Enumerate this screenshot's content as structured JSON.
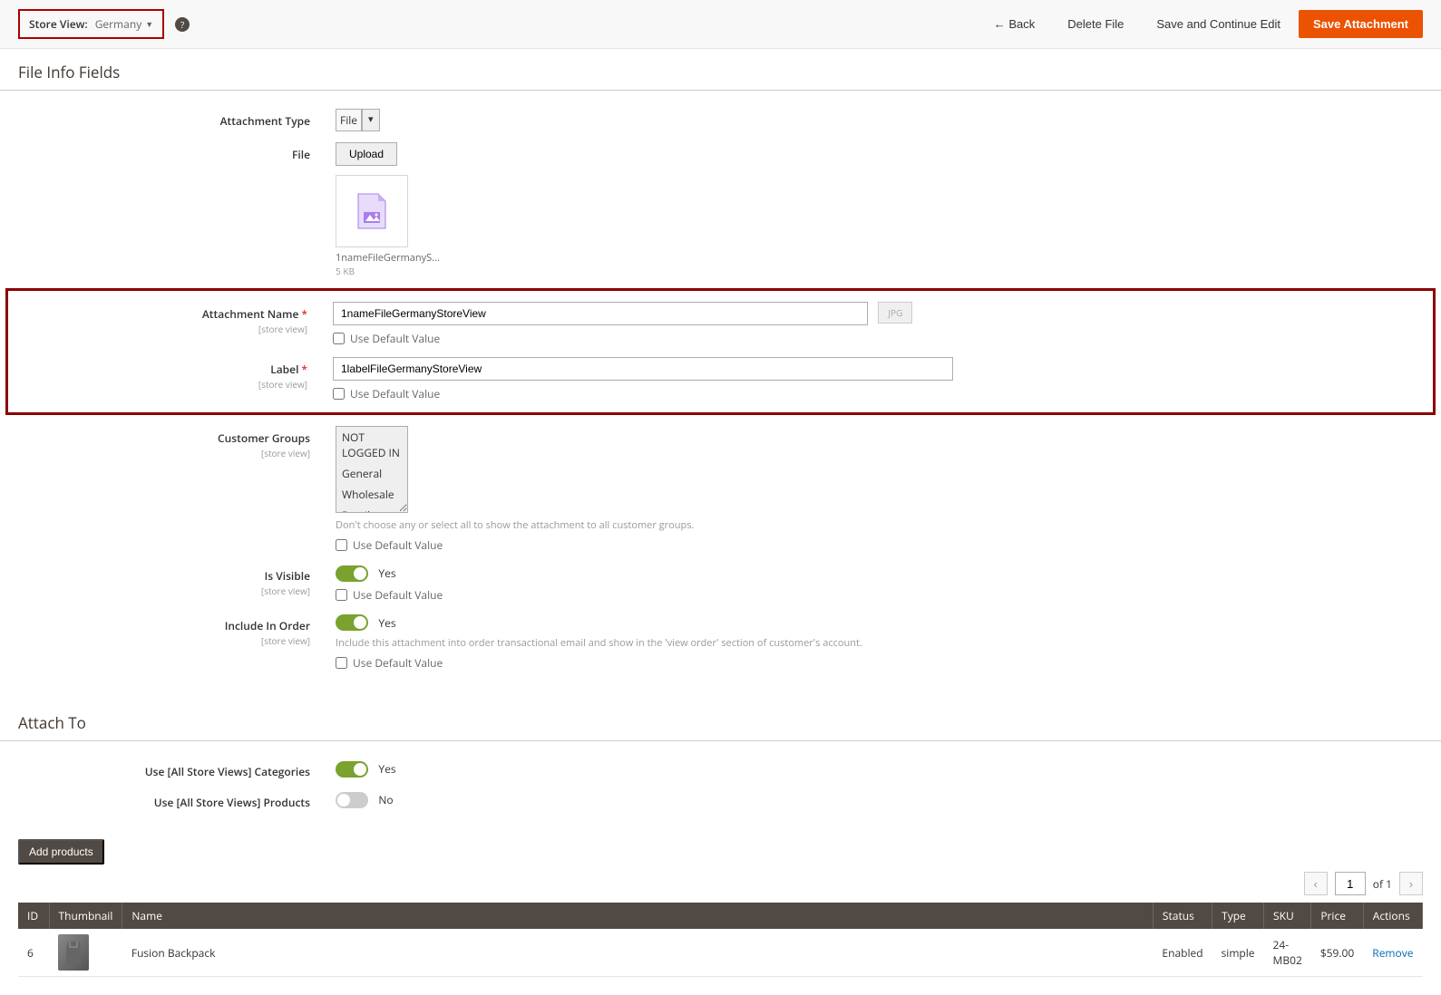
{
  "topbar": {
    "store_view_label": "Store View:",
    "store_view_value": "Germany",
    "back": "Back",
    "delete": "Delete File",
    "save_continue": "Save and Continue Edit",
    "save": "Save Attachment"
  },
  "sections": {
    "file_info": "File Info Fields",
    "attach_to": "Attach To"
  },
  "fields": {
    "attachment_type": {
      "label": "Attachment Type",
      "value": "File"
    },
    "file": {
      "label": "File",
      "upload_btn": "Upload",
      "filename": "1nameFileGermanyS...",
      "filesize": "5 KB"
    },
    "attachment_name": {
      "label": "Attachment Name",
      "scope": "[store view]",
      "value": "1nameFileGermanyStoreView",
      "ext": "jpg"
    },
    "label_field": {
      "label": "Label",
      "scope": "[store view]",
      "value": "1labelFileGermanyStoreView"
    },
    "use_default": "Use Default Value",
    "customer_groups": {
      "label": "Customer Groups",
      "scope": "[store view]",
      "options": [
        "NOT LOGGED IN",
        "General",
        "Wholesale",
        "Retailer"
      ],
      "hint": "Don't choose any or select all to show the attachment to all customer groups."
    },
    "is_visible": {
      "label": "Is Visible",
      "scope": "[store view]",
      "value": "Yes"
    },
    "include_in_order": {
      "label": "Include In Order",
      "scope": "[store view]",
      "value": "Yes",
      "hint": "Include this attachment into order transactional email and show in the 'view order' section of customer's account."
    },
    "use_all_categories": {
      "label": "Use [All Store Views] Categories",
      "value": "Yes"
    },
    "use_all_products": {
      "label": "Use [All Store Views] Products",
      "value": "No"
    }
  },
  "add_products_btn": "Add products",
  "pager": {
    "page": "1",
    "of": "of 1"
  },
  "grid": {
    "headers": {
      "id": "ID",
      "thumbnail": "Thumbnail",
      "name": "Name",
      "status": "Status",
      "type": "Type",
      "sku": "SKU",
      "price": "Price",
      "actions": "Actions"
    },
    "rows": [
      {
        "id": "6",
        "name": "Fusion Backpack",
        "status": "Enabled",
        "type": "simple",
        "sku": "24-MB02",
        "price": "$59.00",
        "action": "Remove"
      }
    ]
  }
}
